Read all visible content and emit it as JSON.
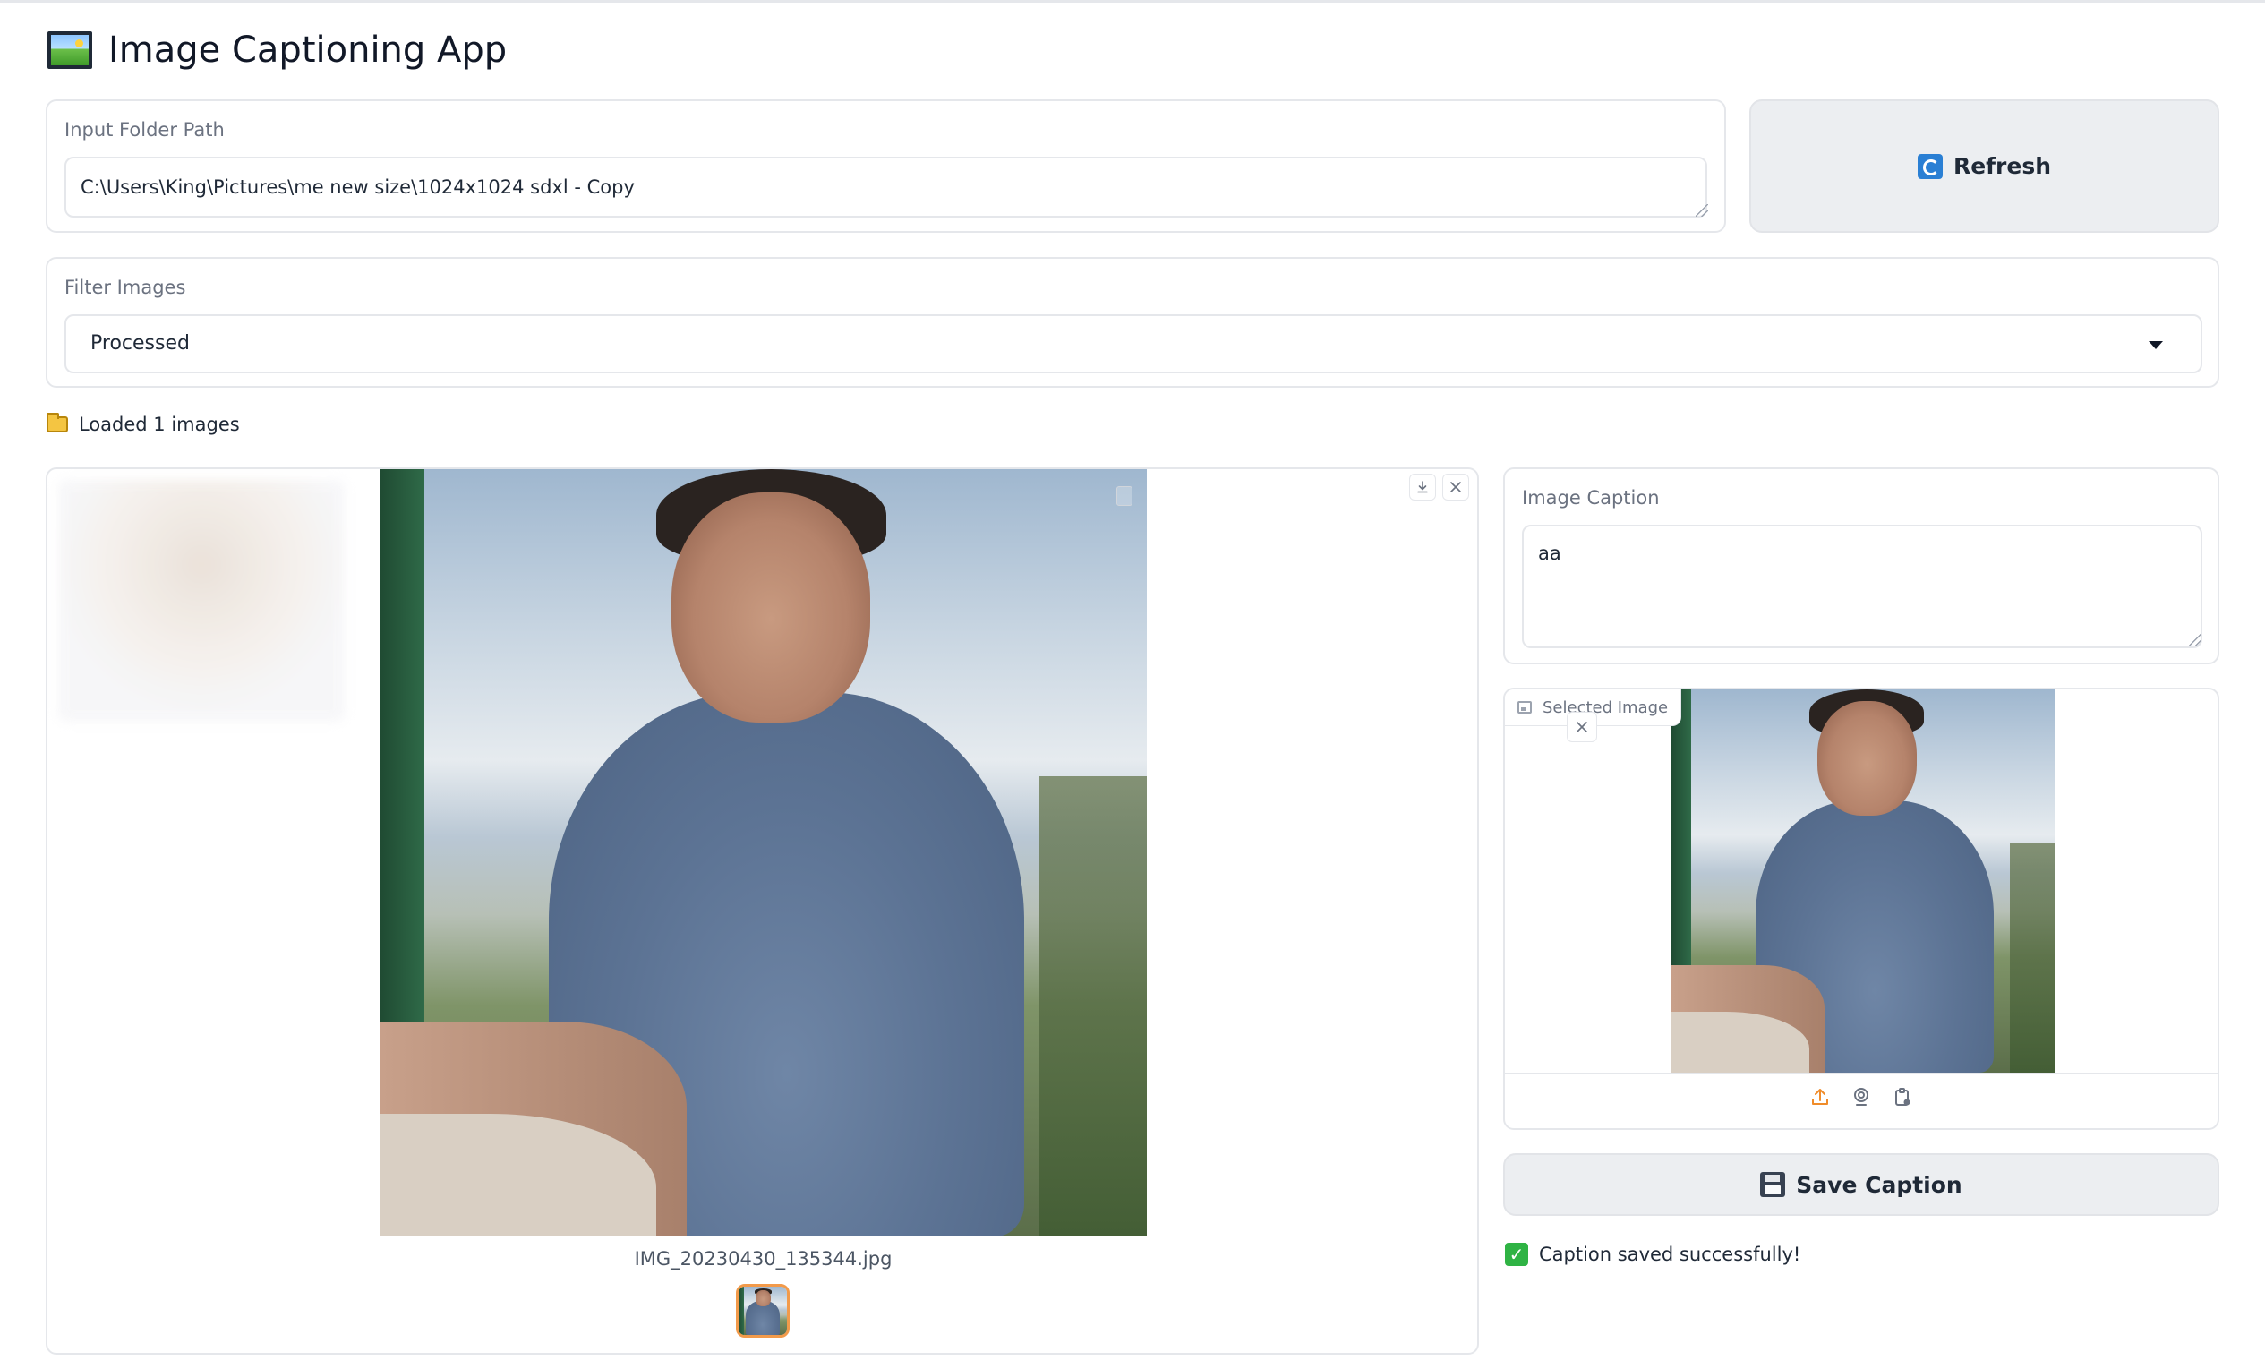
{
  "app": {
    "title": "Image Captioning App",
    "title_icon": "framed-picture-icon"
  },
  "folder": {
    "label": "Input Folder Path",
    "value": "C:\\Users\\King\\Pictures\\me new size\\1024x1024 sdxl - Copy"
  },
  "refresh": {
    "label": "Refresh",
    "icon": "refresh-icon"
  },
  "filter": {
    "label": "Filter Images",
    "selected": "Processed"
  },
  "status": {
    "loaded_text": "Loaded 1 images",
    "icon": "folder-icon"
  },
  "gallery": {
    "selected_filename": "IMG_20230430_135344.jpg",
    "download_icon": "download-icon",
    "close_icon": "close-icon"
  },
  "caption": {
    "label": "Image Caption",
    "value": "aa"
  },
  "selected_image": {
    "label": "Selected Image",
    "icons": [
      "upload-icon",
      "webcam-icon",
      "clipboard-icon"
    ]
  },
  "save": {
    "label": "Save Caption",
    "icon": "floppy-disk-icon"
  },
  "result": {
    "message": "Caption saved successfully!",
    "icon": "check-mark-icon",
    "color": "#2fb344"
  },
  "colors": {
    "accent": "#f08c2a",
    "button_bg": "#eceef1",
    "border": "#e5e7eb"
  }
}
